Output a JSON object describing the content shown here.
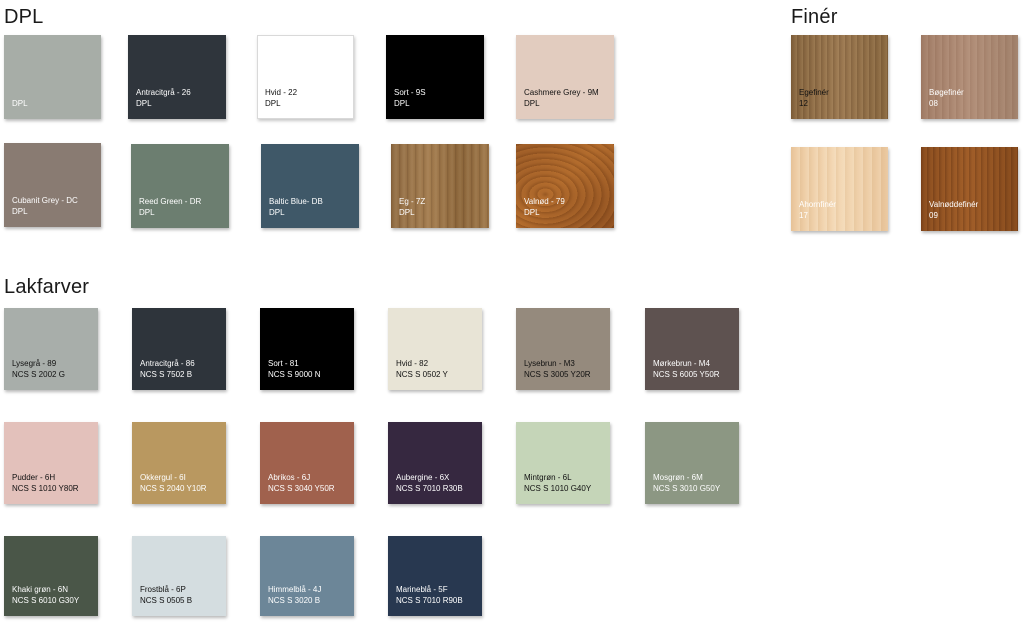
{
  "sections": {
    "dpl": "DPL",
    "finer": "Finér",
    "lak": "Lakfarver"
  },
  "dpl": [
    {
      "line1": "",
      "line2": "DPL",
      "color": "#a7ada7",
      "text": "light"
    },
    {
      "line1": "Antracitgrå - 26",
      "line2": "DPL",
      "color": "#2f353c",
      "text": "light"
    },
    {
      "line1": "Hvid - 22",
      "line2": "DPL",
      "color": "#ffffff",
      "text": "dark"
    },
    {
      "line1": "Sort - 9S",
      "line2": "DPL",
      "color": "#000000",
      "text": "light"
    },
    {
      "line1": "Cashmere Grey - 9M",
      "line2": "DPL",
      "color": "#e2ccbf",
      "text": "dark"
    },
    {
      "line1": "Cubanit Grey - DC",
      "line2": "DPL",
      "color": "#897b72",
      "text": "light"
    },
    {
      "line1": "Reed Green - DR",
      "line2": "DPL",
      "color": "#6c7e70",
      "text": "light"
    },
    {
      "line1": "Baltic Blue- DB",
      "line2": "DPL",
      "color": "#3f5868",
      "text": "light"
    },
    {
      "line1": "Eg - 7Z",
      "line2": "DPL",
      "color": "#9a7448",
      "text": "light"
    },
    {
      "line1": "Valnød - 79",
      "line2": "DPL",
      "color": "#a6622a",
      "text": "light"
    }
  ],
  "finer": [
    {
      "line1": "Egefinér",
      "line2": "12",
      "color": "#906e47",
      "text": "dark"
    },
    {
      "line1": "Bøgefinér",
      "line2": "08",
      "color": "#a98671",
      "text": "light"
    },
    {
      "line1": "Ahornfinér",
      "line2": "17",
      "color": "#efcfa8",
      "text": "light"
    },
    {
      "line1": "Valnøddefinér",
      "line2": "09",
      "color": "#915424",
      "text": "light"
    }
  ],
  "lak": [
    {
      "line1": "Lysegrå - 89",
      "line2": "NCS S 2002 G",
      "color": "#a8aeaa",
      "text": "dark"
    },
    {
      "line1": "Antracitgrå - 86",
      "line2": "NCS S 7502 B",
      "color": "#2e343b",
      "text": "light"
    },
    {
      "line1": "Sort - 81",
      "line2": "NCS S 9000 N",
      "color": "#000000",
      "text": "light"
    },
    {
      "line1": "Hvid - 82",
      "line2": "NCS S 0502 Y",
      "color": "#e8e4d6",
      "text": "dark"
    },
    {
      "line1": "Lysebrun - M3",
      "line2": "NCS S 3005 Y20R",
      "color": "#958a7d",
      "text": "dark"
    },
    {
      "line1": "Mørkebrun - M4",
      "line2": "NCS S 6005 Y50R",
      "color": "#5e5250",
      "text": "light"
    },
    {
      "line1": "Pudder - 6H",
      "line2": "NCS S 1010 Y80R",
      "color": "#e3c1bb",
      "text": "dark"
    },
    {
      "line1": "Okkergul - 6I",
      "line2": "NCS S 2040 Y10R",
      "color": "#b99860",
      "text": "light"
    },
    {
      "line1": "Abrikos - 6J",
      "line2": "NCS S 3040 Y50R",
      "color": "#a0614d",
      "text": "light"
    },
    {
      "line1": "Aubergine - 6X",
      "line2": "NCS S 7010 R30B",
      "color": "#362840",
      "text": "light"
    },
    {
      "line1": "Mintgrøn - 6L",
      "line2": "NCS S 1010 G40Y",
      "color": "#c5d5b8",
      "text": "dark"
    },
    {
      "line1": "Mosgrøn - 6M",
      "line2": "NCS S 3010 G50Y",
      "color": "#8c9783",
      "text": "light"
    },
    {
      "line1": "Khaki grøn - 6N",
      "line2": "NCS S 6010 G30Y",
      "color": "#4a5648",
      "text": "light"
    },
    {
      "line1": "Frostblå - 6P",
      "line2": "NCS S 0505 B",
      "color": "#d4dde0",
      "text": "dark"
    },
    {
      "line1": "Himmelblå - 4J",
      "line2": "NCS S 3020 B",
      "color": "#6c8698",
      "text": "light"
    },
    {
      "line1": "Marineblå - 5F",
      "line2": "NCS S 7010 R90B",
      "color": "#283850",
      "text": "light"
    }
  ]
}
